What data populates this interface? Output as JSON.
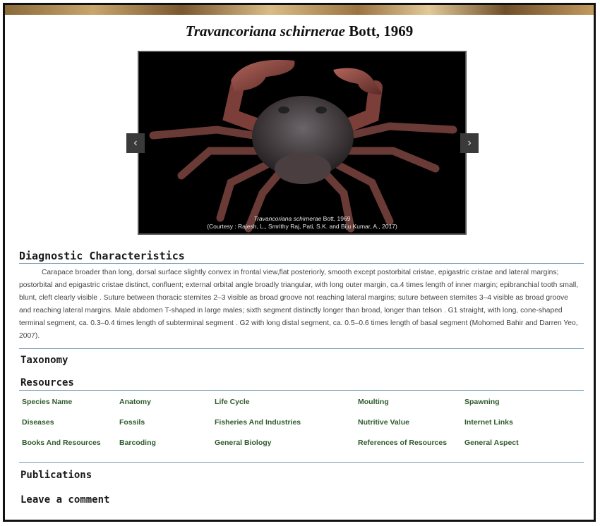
{
  "species": {
    "name": "Travancoriana schirnerae",
    "author": "Bott, 1969"
  },
  "image": {
    "caption_species": "Travancoriana schirnerae",
    "caption_author": "Bott, 1969",
    "caption_credit": "(Courtesy : Rajesh, L., Smrithy Raj, Pati, S.K. and Biju Kumar, A., 2017)",
    "prev_icon": "‹",
    "next_icon": "›"
  },
  "diagnostic": {
    "heading": "Diagnostic Characteristics",
    "text": "Carapace broader than long, dorsal surface slightly convex in frontal view,flat posteriorly, smooth except postorbital cristae, epigastric cristae and lateral margins; postorbital and epigastric cristae distinct, confluent; external orbital angle broadly triangular, with long outer margin, ca.4 times length of inner margin; epibranchial tooth small, blunt, cleft clearly visible . Suture between thoracic sternites 2–3 visible as broad groove not reaching lateral margins; suture between sternites 3–4 visible as broad groove and reaching lateral margins. Male abdomen T-shaped in large males; sixth segment distinctly longer than broad, longer than telson . G1 straight, with long, cone-shaped terminal segment, ca. 0.3–0.4 times length of subterminal segment . G2 with long distal segment, ca. 0.5–0.6 times length of basal segment (Mohomed Bahir and Darren Yeo, 2007)."
  },
  "taxonomy": {
    "heading": "Taxonomy"
  },
  "resources": {
    "heading": "Resources",
    "links": [
      "Species Name",
      "Anatomy",
      "Life Cycle",
      "Moulting",
      "Spawning",
      "Diseases",
      "Fossils",
      "Fisheries And Industries",
      "Nutritive Value",
      "Internet Links",
      "Books And Resources",
      "Barcoding",
      "General Biology",
      "References of Resources",
      "General Aspect"
    ]
  },
  "publications": {
    "heading": "Publications"
  },
  "comment": {
    "heading": "Leave a comment"
  }
}
